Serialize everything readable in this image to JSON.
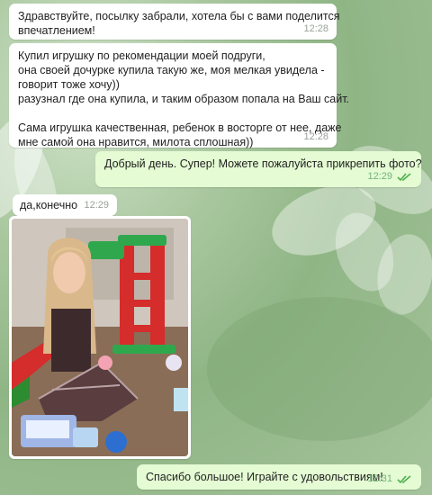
{
  "messages": [
    {
      "lines": [
        "Здравствуйте, посылку забрали, хотела бы с вами поделится",
        "впечатлением!"
      ],
      "time": "12:28"
    },
    {
      "lines": [
        "Купил игрушку по рекомендации моей подруги,",
        "она своей дочурке купила такую же, моя мелкая увидела -",
        "говорит тоже хочу))",
        " разузнал где она купила, и таким образом попала на Ваш сайт.",
        "",
        "Сама игрушка качественная, ребенок в восторге от нее, даже",
        "мне самой она нравится, милота сплошная))"
      ],
      "time": "12:28"
    },
    {
      "text": "Добрый день. Супер! Можете пожалуйста прикрепить фото?",
      "time": "12:29"
    },
    {
      "text": "да,конечно",
      "time": "12:29"
    },
    {
      "text": "Спасибо большое! Играйте с удовольствиям!",
      "time": "12:31"
    }
  ],
  "colors": {
    "incoming": "#ffffff",
    "outgoing": "#e4fbd3",
    "read_ticks": "#4fae4e"
  },
  "icons": [
    "double-check-icon"
  ]
}
